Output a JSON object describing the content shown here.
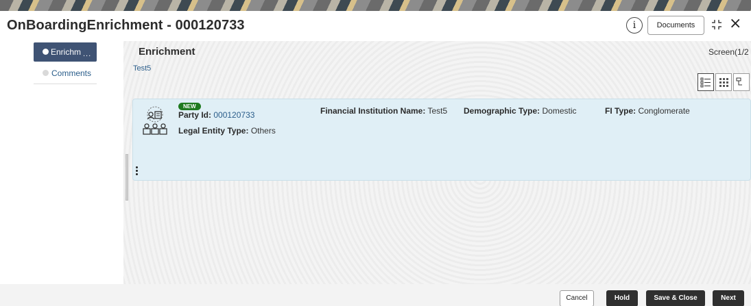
{
  "header": {
    "title": "OnBoardingEnrichment - 000120733",
    "info_glyph": "i",
    "documents_label": "Documents",
    "close_glyph": "×"
  },
  "nav": {
    "items": [
      {
        "label": "Enrichm",
        "more": "...",
        "active": true
      },
      {
        "label": "Comments",
        "active": false
      }
    ]
  },
  "main": {
    "section_title": "Enrichment",
    "screen_counter": "Screen(1/2",
    "crumb": "Test5",
    "card": {
      "badge": "NEW",
      "party_id_label": "Party Id:",
      "party_id_value": "000120733",
      "legal_entity_label": "Legal Entity Type:",
      "legal_entity_value": "Others",
      "fi_name_label": "Financial Institution Name:",
      "fi_name_value": "Test5",
      "demographic_label": "Demographic Type:",
      "demographic_value": "Domestic",
      "fi_type_label": "FI Type:",
      "fi_type_value": "Conglomerate"
    }
  },
  "footer": {
    "cancel_label": "Cancel",
    "hold_label": "Hold",
    "save_close_label": "Save & Close",
    "next_label": "Next"
  },
  "colors": {
    "nav_active": "#3f5374",
    "card_bg": "#e0eff6",
    "link": "#2a5d8a",
    "badge_new": "#1f7a1f",
    "dark_button": "#2f2f2f"
  }
}
